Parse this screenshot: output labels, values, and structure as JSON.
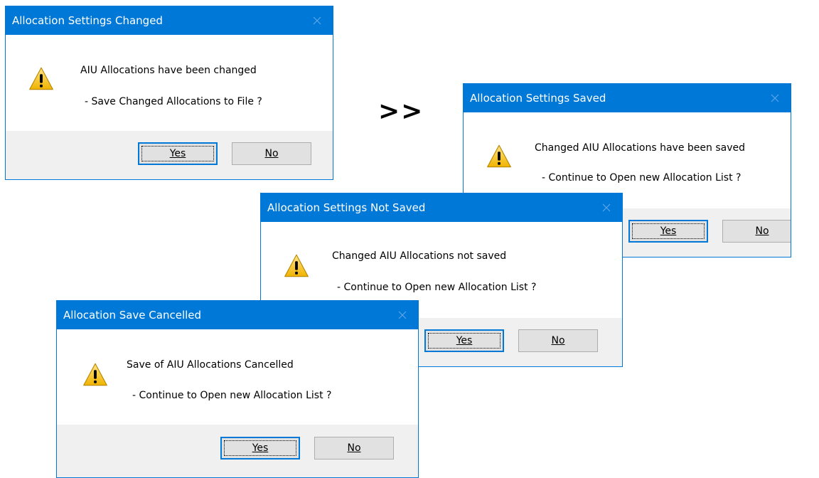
{
  "arrow_text": ">>",
  "colors": {
    "titlebar": "#0078d7",
    "footer": "#f0f0f0",
    "button": "#e1e1e1"
  },
  "icons": {
    "warning": "warning-icon",
    "close": "close-icon"
  },
  "dialogs": [
    {
      "title": "Allocation Settings Changed",
      "line1": "AIU Allocations have been changed",
      "line2": "- Save Changed Allocations to File ?",
      "yes": "Yes",
      "no": "No"
    },
    {
      "title": "Allocation Settings Saved",
      "line1": "Changed AIU Allocations have been saved",
      "line2": "- Continue to Open new Allocation List ?",
      "yes": "Yes",
      "no": "No"
    },
    {
      "title": "Allocation Settings Not Saved",
      "line1": "Changed AIU Allocations not saved",
      "line2": "- Continue to Open new Allocation List ?",
      "yes": "Yes",
      "no": "No"
    },
    {
      "title": "Allocation Save Cancelled",
      "line1": "Save of AIU Allocations Cancelled",
      "line2": "- Continue to Open new Allocation List ?",
      "yes": "Yes",
      "no": "No"
    }
  ]
}
